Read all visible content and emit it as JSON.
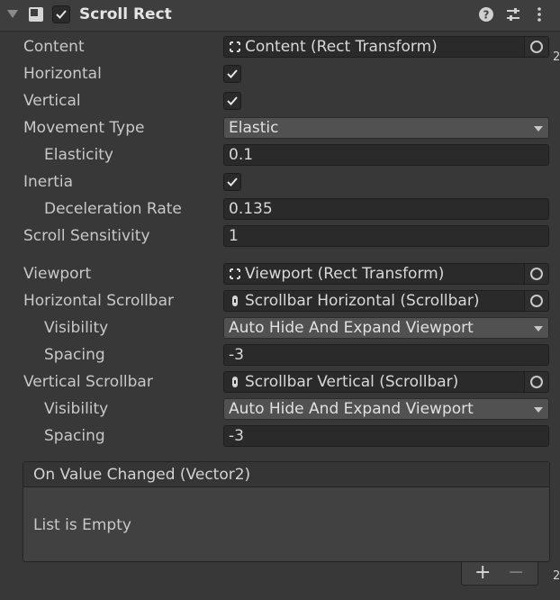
{
  "header": {
    "title": "Scroll Rect",
    "enabled": true
  },
  "rows": {
    "content": {
      "label": "Content",
      "value": "Content (Rect Transform)"
    },
    "horizontal": {
      "label": "Horizontal",
      "checked": true
    },
    "vertical": {
      "label": "Vertical",
      "checked": true
    },
    "movement_type": {
      "label": "Movement Type",
      "value": "Elastic"
    },
    "elasticity": {
      "label": "Elasticity",
      "value": "0.1"
    },
    "inertia": {
      "label": "Inertia",
      "checked": true
    },
    "deceleration_rate": {
      "label": "Deceleration Rate",
      "value": "0.135"
    },
    "scroll_sensitivity": {
      "label": "Scroll Sensitivity",
      "value": "1"
    },
    "viewport": {
      "label": "Viewport",
      "value": "Viewport (Rect Transform)"
    },
    "horizontal_scrollbar": {
      "label": "Horizontal Scrollbar",
      "value": "Scrollbar Horizontal (Scrollbar)"
    },
    "h_visibility": {
      "label": "Visibility",
      "value": "Auto Hide And Expand Viewport"
    },
    "h_spacing": {
      "label": "Spacing",
      "value": "-3"
    },
    "vertical_scrollbar": {
      "label": "Vertical Scrollbar",
      "value": "Scrollbar Vertical (Scrollbar)"
    },
    "v_visibility": {
      "label": "Visibility",
      "value": "Auto Hide And Expand Viewport"
    },
    "v_spacing": {
      "label": "Spacing",
      "value": "-3"
    }
  },
  "event": {
    "title": "On Value Changed (Vector2)",
    "empty_text": "List is Empty",
    "add_label": "+",
    "remove_label": "−"
  },
  "edge_marks": {
    "top": "2",
    "bottom": "2"
  },
  "colors": {
    "background": "#383838",
    "field": "#2a2a2a",
    "dropdown": "#515151",
    "text": "#d2d2d2"
  },
  "icons": [
    "foldout-arrow-icon",
    "component-icon",
    "help-icon",
    "preset-icon",
    "more-menu-icon",
    "rect-transform-icon",
    "scrollbar-icon",
    "object-picker-icon",
    "checkmark-icon"
  ]
}
